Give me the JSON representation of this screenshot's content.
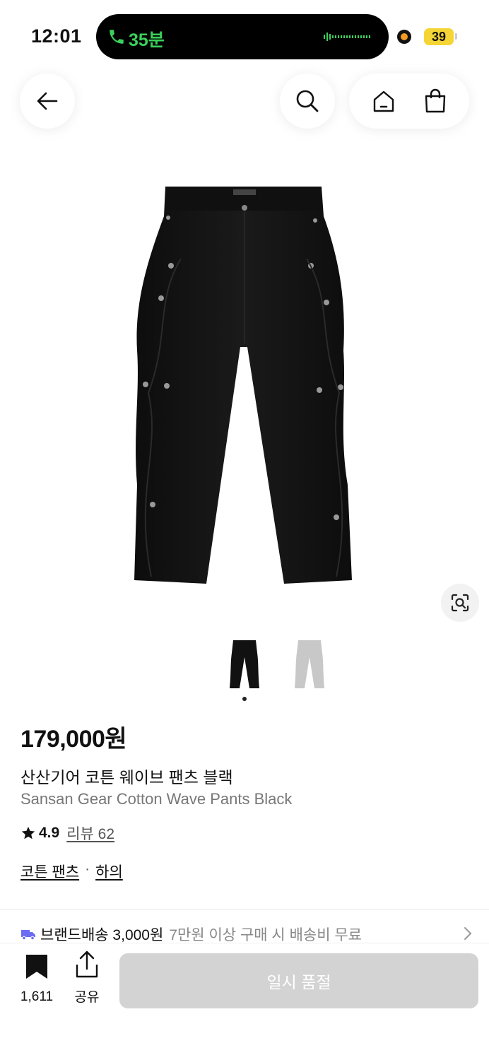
{
  "status_bar": {
    "time": "12:01",
    "call_duration": "35분",
    "battery": "39"
  },
  "product": {
    "price": "179,000원",
    "name_ko": "산산기어 코튼 웨이브 팬츠 블랙",
    "name_en": "Sansan Gear Cotton Wave Pants Black",
    "rating": "4.9",
    "review_label": "리뷰 62",
    "categories": [
      "코튼 팬츠",
      "하의"
    ],
    "category_separator": "·",
    "colors": {
      "main_thumb": "#111111",
      "alt_thumb": "#c8c8c8"
    }
  },
  "shipping": {
    "brand_text": "브랜드배송 3,000원",
    "condition_text": "7만원 이상 구매 시 배송비 무료",
    "icon_color": "#6b6cf2"
  },
  "bottom_bar": {
    "bookmark_count": "1,611",
    "share_label": "공유",
    "cta_label": "일시 품절"
  },
  "icons": [
    "back-arrow-icon",
    "search-icon",
    "home-icon",
    "shopping-bag-icon",
    "lens-icon",
    "bookmark-icon",
    "share-icon",
    "truck-icon",
    "chevron-right-icon",
    "phone-icon"
  ],
  "accent_colors": {
    "call_green": "#3ad05b",
    "battery_yellow": "#f5d535",
    "record_orange": "#f59a23",
    "disabled_button": "#d3d3d3"
  }
}
